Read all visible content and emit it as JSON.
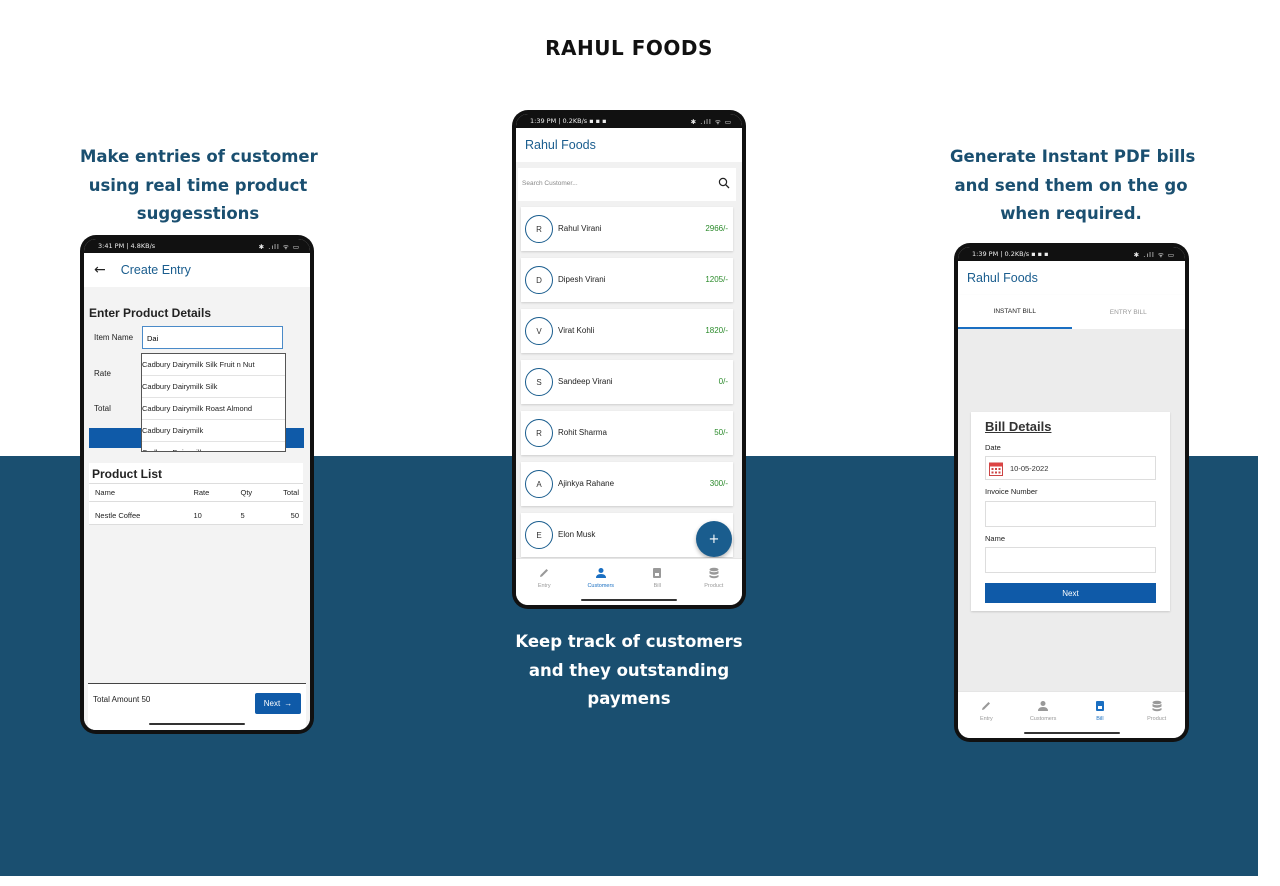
{
  "page_title": "RAHUL FOODS",
  "captions": {
    "left": [
      "Make entries of customer",
      "using real time product",
      "suggesstions"
    ],
    "middle": [
      "Keep track of  customers",
      "and they outstanding",
      "paymens"
    ],
    "right": [
      "Generate Instant PDF bills",
      "and send them on the go",
      "when required."
    ]
  },
  "colors": {
    "band": "#1a4f70",
    "primary": "#0f5aa8",
    "amount_green": "#2a8a2a"
  },
  "phone1": {
    "status_left": "3:41 PM | 4.8KB/s",
    "status_right": "✱ .ıll ᯤ ▭",
    "title": "Create Entry",
    "section_title": "Enter Product Details",
    "labels": {
      "item_name": "Item Name",
      "rate": "Rate",
      "total": "Total"
    },
    "item_name_value": "Dai",
    "suggestions": [
      "Cadbury Dairymilk Silk Fruit n Nut",
      "Cadbury Dairymilk Silk",
      "Cadbury Dairymilk Roast Almond",
      "Cadbury Dairymilk",
      "Cadbury Dairymilk"
    ],
    "product_list_title": "Product List",
    "table_headers": {
      "name": "Name",
      "rate": "Rate",
      "qty": "Qty",
      "total": "Total"
    },
    "rows": [
      {
        "name": "Nestle Coffee",
        "rate": "10",
        "qty": "5",
        "total": "50"
      }
    ],
    "total_amount": "Total Amount 50",
    "next_label": "Next"
  },
  "phone2": {
    "status_left": "1:39 PM | 0.2KB/s ▪ ▪ ▪",
    "status_right": "✱ .ıll ᯤ ▭",
    "title": "Rahul Foods",
    "search_placeholder": "Search Customer...",
    "customers": [
      {
        "initial": "R",
        "name": "Rahul Virani",
        "amount": "2966/-"
      },
      {
        "initial": "D",
        "name": "Dipesh Virani",
        "amount": "1205/-"
      },
      {
        "initial": "V",
        "name": "Virat Kohli",
        "amount": "1820/-"
      },
      {
        "initial": "S",
        "name": "Sandeep Virani",
        "amount": "0/-"
      },
      {
        "initial": "R",
        "name": "Rohit Sharma",
        "amount": "50/-"
      },
      {
        "initial": "A",
        "name": "Ajinkya Rahane",
        "amount": "300/-"
      },
      {
        "initial": "E",
        "name": "Elon Musk",
        "amount": ""
      }
    ],
    "fab": "+",
    "nav": {
      "entry": "Entry",
      "customers": "Customers",
      "bill": "Bill",
      "product": "Product"
    }
  },
  "phone3": {
    "status_left": "1:39 PM | 0.2KB/s ▪ ▪ ▪",
    "status_right": "✱ .ıll ᯤ ▭",
    "title": "Rahul Foods",
    "tabs": {
      "instant": "INSTANT BILL",
      "entry": "ENTRY BILL"
    },
    "card_title": "Bill Details",
    "date_label": "Date",
    "date_value": "10-05-2022",
    "invoice_label": "Invoice Number",
    "name_label": "Name",
    "next_label": "Next",
    "nav": {
      "entry": "Entry",
      "customers": "Customers",
      "bill": "Bill",
      "product": "Product"
    }
  }
}
